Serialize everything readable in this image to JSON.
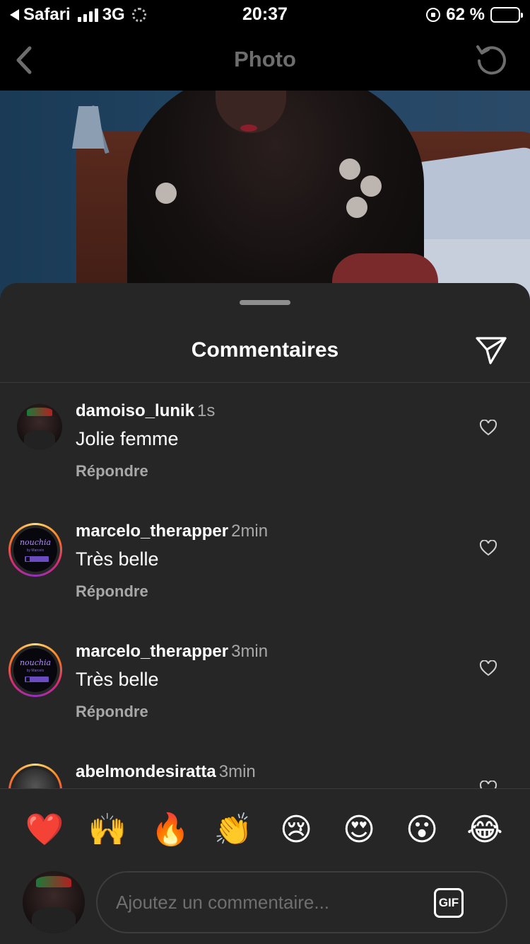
{
  "status_bar": {
    "carrier": "Safari",
    "network": "3G",
    "time": "20:37",
    "battery_percent": "62 %",
    "battery_level": 0.62,
    "battery_color": "#ffd60a"
  },
  "nav": {
    "title": "Photo",
    "back_icon": "chevron-left-icon",
    "refresh_icon": "refresh-icon"
  },
  "sheet": {
    "title": "Commentaires",
    "share_icon": "paper-plane-icon"
  },
  "comments": [
    {
      "user": "damoiso_lunik",
      "time": "1s",
      "text": "Jolie femme",
      "reply": "Répondre",
      "avatar": "man-photo",
      "story_ring": false
    },
    {
      "user": "marcelo_therapper",
      "time": "2min",
      "text": "Très belle",
      "reply": "Répondre",
      "avatar": "nouchia-logo",
      "story_ring": true
    },
    {
      "user": "marcelo_therapper",
      "time": "3min",
      "text": "Très belle",
      "reply": "Répondre",
      "avatar": "nouchia-logo",
      "story_ring": true
    },
    {
      "user": "abelmondesiratta",
      "time": "3min",
      "text": "",
      "reply": "",
      "avatar": "gray-photo",
      "story_ring": true
    }
  ],
  "avatar_logo": {
    "title": "nouchia",
    "subtitle": "by Marcelo"
  },
  "emojis": [
    "❤️",
    "🙌",
    "🔥",
    "👏",
    "😢",
    "😍",
    "😮",
    "😂"
  ],
  "composer": {
    "placeholder": "Ajoutez un commentaire...",
    "gif_label": "GIF"
  },
  "colors": {
    "sheet_bg": "#262626",
    "secondary_text": "#a8a8a8",
    "placeholder_text": "#6f6f6f"
  }
}
